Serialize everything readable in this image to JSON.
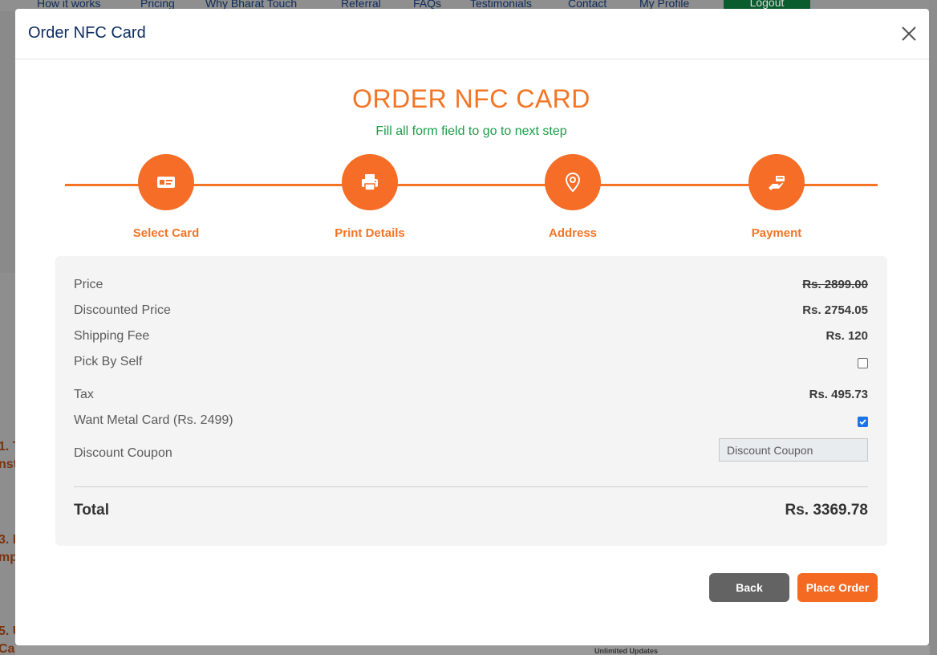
{
  "background": {
    "nav_items": [
      "How it works",
      "Pricing",
      "Why Bharat Touch",
      "Referral",
      "FAQs",
      "Testimonials",
      "Contact",
      "My Profile"
    ],
    "logout_label": "Logout",
    "left_fragments": [
      "1. T",
      "nst",
      "3. N",
      "mp",
      "5. U",
      "Card"
    ],
    "bottom_fragment": "Unlimited Updates"
  },
  "modal": {
    "title": "Order NFC Card",
    "close_icon": "close-icon"
  },
  "form": {
    "heading": "ORDER NFC CARD",
    "subheading": "Fill all form field to go to next step"
  },
  "steps": [
    {
      "label": "Select Card",
      "icon": "id-card-icon"
    },
    {
      "label": "Print Details",
      "icon": "printer-icon"
    },
    {
      "label": "Address",
      "icon": "map-pin-icon"
    },
    {
      "label": "Payment",
      "icon": "payment-hand-icon"
    }
  ],
  "summary": {
    "price_label": "Price",
    "price_value": "Rs. 2899.00",
    "discounted_label": "Discounted Price",
    "discounted_value": "Rs. 2754.05",
    "shipping_label": "Shipping Fee",
    "shipping_value": "Rs. 120",
    "pickself_label": "Pick By Self",
    "pickself_checked": false,
    "tax_label": "Tax",
    "tax_value": "Rs. 495.73",
    "metal_label": "Want Metal Card (Rs. 2499)",
    "metal_checked": true,
    "coupon_label": "Discount Coupon",
    "coupon_placeholder": "Discount Coupon",
    "total_label": "Total",
    "total_value": "Rs. 3369.78"
  },
  "buttons": {
    "back_label": "Back",
    "order_label": "Place Order"
  },
  "colors": {
    "accent": "#f47424",
    "title_blue": "#0f2d62",
    "success_green": "#1b9c49",
    "checkbox_blue": "#1a73e8"
  }
}
